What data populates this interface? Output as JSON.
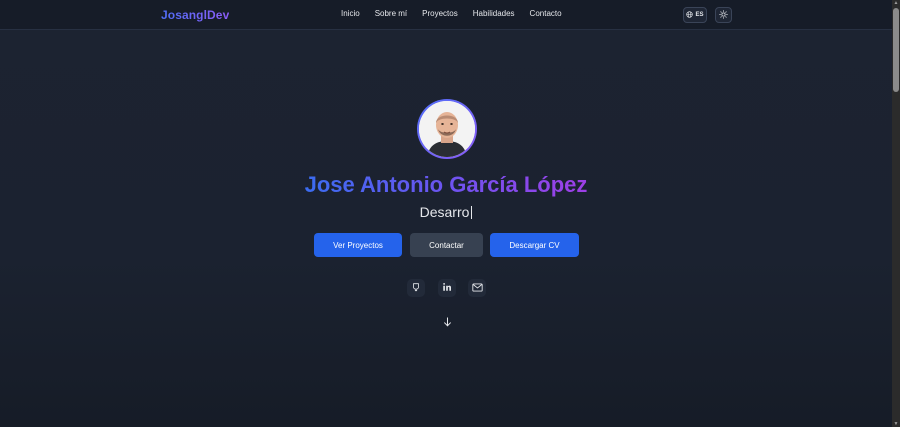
{
  "nav": {
    "brand": "JosanglDev",
    "links": [
      "Inicio",
      "Sobre mí",
      "Proyectos",
      "Habilidades",
      "Contacto"
    ],
    "language": "ES",
    "icons": {
      "language": "globe-icon",
      "theme": "sun-icon"
    }
  },
  "hero": {
    "name": "Jose Antonio García López",
    "role_typed": "Desarro",
    "buttons": {
      "projects": "Ver Proyectos",
      "contact": "Contactar",
      "cv": "Descargar CV"
    },
    "social_icons": [
      "github-icon",
      "linkedin-icon",
      "mail-icon"
    ],
    "scroll_icon": "arrow-down-icon"
  },
  "colors": {
    "primary": "#2563eb",
    "secondary": "#374151",
    "gradient_start": "#4f6ef7",
    "gradient_end": "#8b5cf6",
    "background": "#1c2331"
  }
}
